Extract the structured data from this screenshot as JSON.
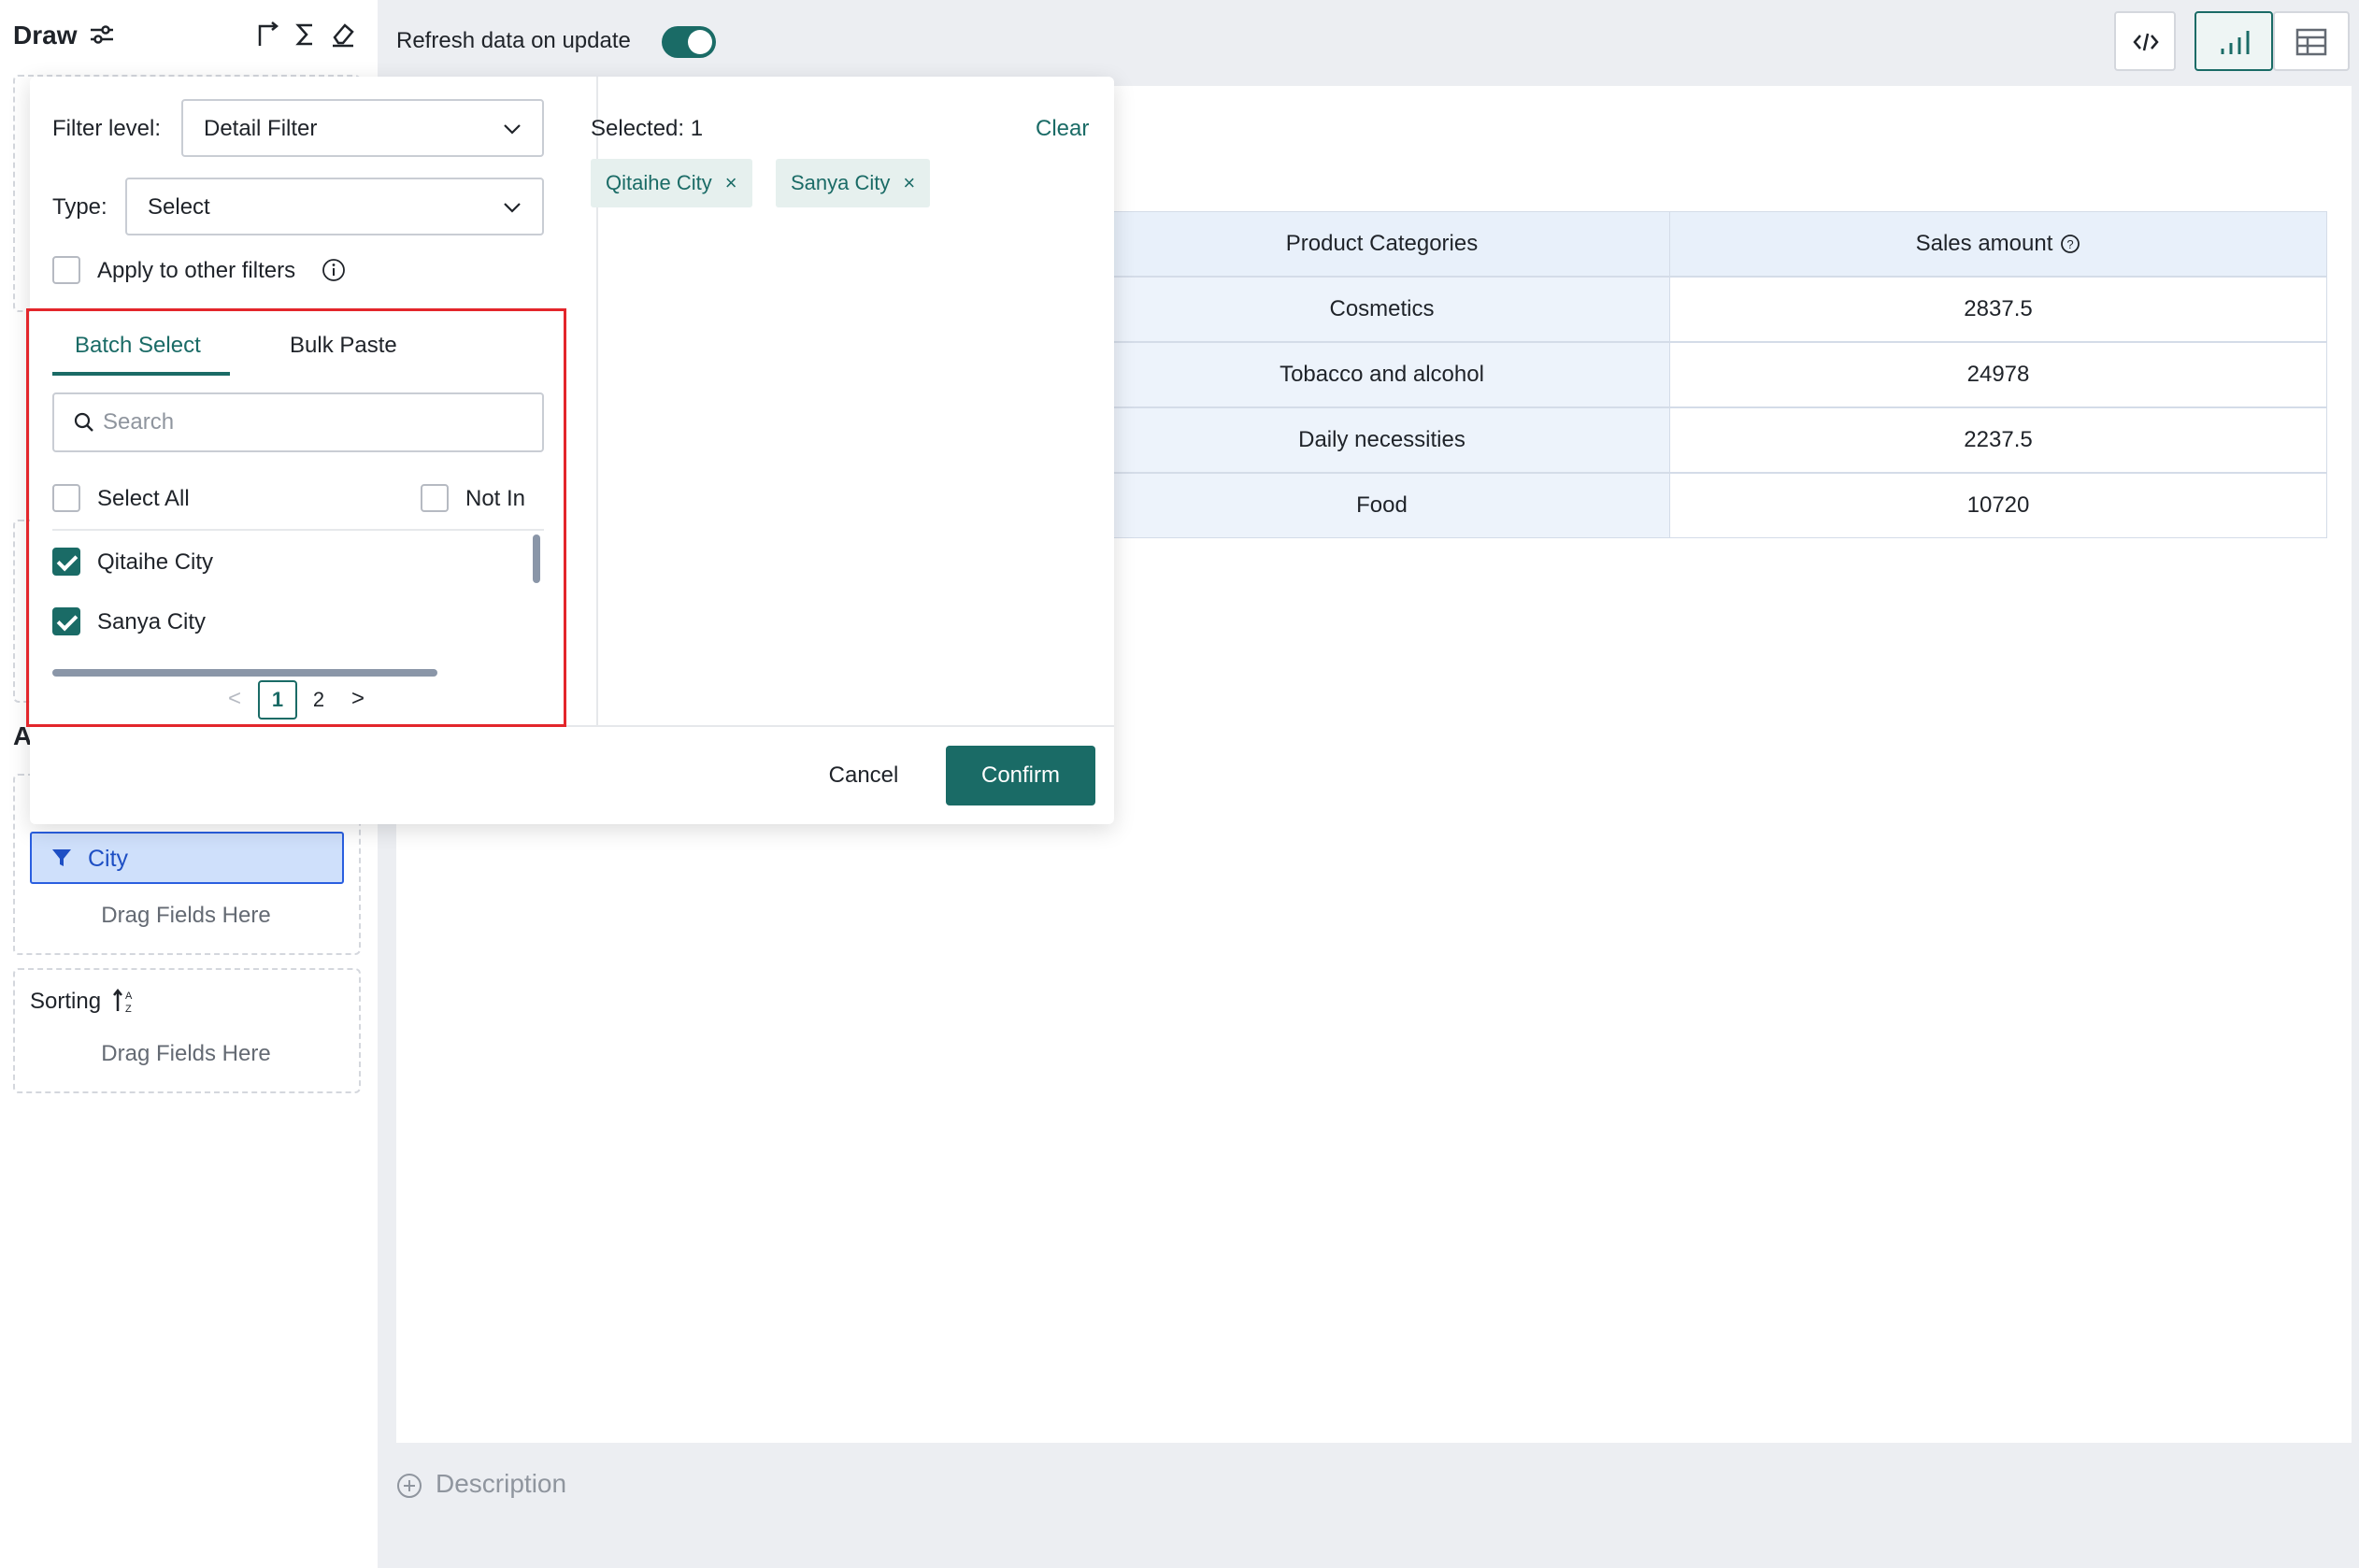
{
  "sidebar": {
    "title": "Draw",
    "section_letter": "A",
    "filter_pill": "City",
    "drag_hint_1": "Drag Fields Here",
    "sorting_title": "Sorting",
    "drag_hint_2": "Drag Fields Here"
  },
  "topbar": {
    "refresh_label": "Refresh data on update",
    "refresh_on": true
  },
  "table": {
    "headers": [
      "Product Categories",
      "Sales amount"
    ],
    "rows": [
      {
        "category": "Cosmetics",
        "amount": "2837.5"
      },
      {
        "category": "Tobacco and alcohol",
        "amount": "24978"
      },
      {
        "category": "Daily necessities",
        "amount": "2237.5"
      },
      {
        "category": "Food",
        "amount": "10720"
      }
    ]
  },
  "description": "Description",
  "popup": {
    "filter_level_label": "Filter level:",
    "filter_level_value": "Detail Filter",
    "type_label": "Type:",
    "type_value": "Select",
    "apply_label": "Apply to other filters",
    "tabs": [
      "Batch Select",
      "Bulk Paste"
    ],
    "search_placeholder": "Search",
    "select_all": "Select All",
    "not_in": "Not In",
    "items": [
      {
        "label": "Qitaihe City",
        "checked": true
      },
      {
        "label": "Sanya City",
        "checked": true
      }
    ],
    "pagination": {
      "prev": "<",
      "pages": [
        "1",
        "2"
      ],
      "next": ">"
    },
    "selected_label": "Selected: 1",
    "clear": "Clear",
    "tags": [
      "Qitaihe City",
      "Sanya City"
    ],
    "tag_remove": "×",
    "cancel": "Cancel",
    "confirm": "Confirm"
  },
  "colors": {
    "accent": "#1a6b66",
    "highlight_frame": "#e3262b",
    "filter_pill_bg": "#cfe0fb"
  }
}
